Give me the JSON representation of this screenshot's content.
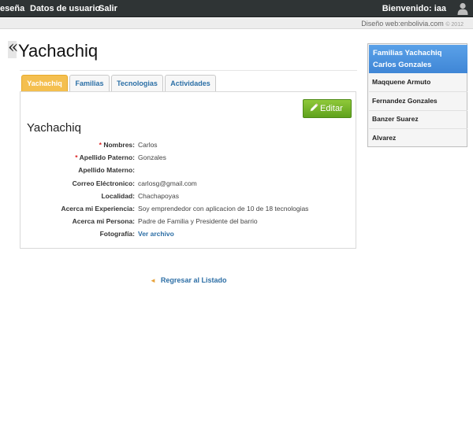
{
  "topbar": {
    "nav": [
      "eseña",
      "Datos de usuario",
      "Salir"
    ],
    "welcome": "Bienvenido: iaa"
  },
  "subbar": {
    "credit": "Diseño web:enbolivia.com",
    "copyright": "© 2012"
  },
  "page": {
    "back_quote": "«",
    "title": "Yachachiq"
  },
  "tabs": [
    "Yachachiq",
    "Familias",
    "Tecnologias",
    "Actividades"
  ],
  "active_tab": "Yachachiq",
  "panel": {
    "edit_label": "Editar",
    "section_title": "Yachachiq",
    "fields": [
      {
        "required": "*",
        "label": "Nombres:",
        "value": "Carlos"
      },
      {
        "required": "*",
        "label": "Apellido Paterno:",
        "value": "Gonzales"
      },
      {
        "required": "",
        "label": "Apellido Materno:",
        "value": ""
      },
      {
        "required": "",
        "label": "Correo Eléctronico:",
        "value": "carlosg@gmail.com"
      },
      {
        "required": "",
        "label": "Localidad:",
        "value": "Chachapoyas"
      },
      {
        "required": "",
        "label": "Acerca mi Experiencia:",
        "value": "Soy emprendedor con aplicacion de 10 de 18 tecnologias"
      },
      {
        "required": "",
        "label": "Acerca mi Persona:",
        "value": "Padre de Familia y Presidente del barrio"
      },
      {
        "required": "",
        "label": "Fotografía:",
        "value": "Ver archivo"
      }
    ]
  },
  "back_link": {
    "arrow": "◄",
    "label": "Regresar al Listado"
  },
  "sidebar": {
    "title_line1": "Familias Yachachiq",
    "title_line2": "Carlos Gonzales",
    "items": [
      "Maqquene Armuto",
      "Fernandez Gonzales",
      "Banzer Suarez",
      "Alvarez"
    ]
  },
  "colors": {
    "topbar": "#2f3435",
    "active_tab": "#f4bf4f",
    "edit_button": "#6fb126",
    "sidebar_header": "#4a90de",
    "link": "#2c6ea5"
  }
}
